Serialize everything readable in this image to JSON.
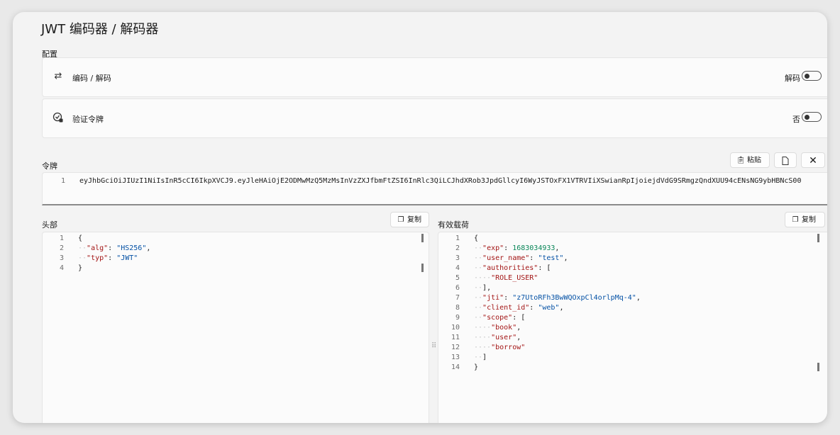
{
  "app": {
    "title": "JWT 编码器 / 解码器"
  },
  "config": {
    "section_label": "配置",
    "encode_decode": {
      "icon": "arrows-swap-icon",
      "label": "编码 / 解码",
      "state": "解码",
      "toggle_on": false
    },
    "verify_token": {
      "icon": "check-badge-icon",
      "label": "验证令牌",
      "state": "否",
      "toggle_on": false
    }
  },
  "token": {
    "section_label": "令牌",
    "paste_label": "粘贴",
    "line_number": "1",
    "value": "eyJhbGciOiJIUzI1NiIsInR5cCI6IkpXVCJ9.eyJleHAiOjE2ODMwMzQ5MzMsInVzZXJfbmFtZSI6InRlc3QiLCJhdXRob3JpdGllcyI6WyJSTOxFX1VTRVIiXSwianRpIjoiejdVdG9SRmgzQndXUU94cENsNG9ybHBNcS00"
  },
  "header": {
    "section_label": "头部",
    "copy_label": "复制",
    "lines": [
      {
        "n": "1",
        "indent": 0,
        "parts": [
          [
            "p",
            "{"
          ]
        ]
      },
      {
        "n": "2",
        "indent": 1,
        "parts": [
          [
            "k",
            "\"alg\""
          ],
          [
            "p",
            ": "
          ],
          [
            "s",
            "\"HS256\""
          ],
          [
            "p",
            ","
          ]
        ]
      },
      {
        "n": "3",
        "indent": 1,
        "parts": [
          [
            "k",
            "\"typ\""
          ],
          [
            "p",
            ": "
          ],
          [
            "s",
            "\"JWT\""
          ]
        ]
      },
      {
        "n": "4",
        "indent": 0,
        "parts": [
          [
            "p",
            "}"
          ]
        ]
      }
    ]
  },
  "payload": {
    "section_label": "有效载荷",
    "copy_label": "复制",
    "lines": [
      {
        "n": "1",
        "indent": 0,
        "parts": [
          [
            "p",
            "{"
          ]
        ]
      },
      {
        "n": "2",
        "indent": 1,
        "parts": [
          [
            "k",
            "\"exp\""
          ],
          [
            "p",
            ": "
          ],
          [
            "num",
            "1683034933"
          ],
          [
            "p",
            ","
          ]
        ]
      },
      {
        "n": "3",
        "indent": 1,
        "parts": [
          [
            "k",
            "\"user_name\""
          ],
          [
            "p",
            ": "
          ],
          [
            "s",
            "\"test\""
          ],
          [
            "p",
            ","
          ]
        ]
      },
      {
        "n": "4",
        "indent": 1,
        "parts": [
          [
            "k",
            "\"authorities\""
          ],
          [
            "p",
            ": ["
          ]
        ]
      },
      {
        "n": "5",
        "indent": 2,
        "parts": [
          [
            "k",
            "\"ROLE_USER\""
          ]
        ]
      },
      {
        "n": "6",
        "indent": 1,
        "parts": [
          [
            "p",
            "],"
          ]
        ]
      },
      {
        "n": "7",
        "indent": 1,
        "parts": [
          [
            "k",
            "\"jti\""
          ],
          [
            "p",
            ": "
          ],
          [
            "s",
            "\"z7UtoRFh3BwWQOxpCl4orlpMq-4\""
          ],
          [
            "p",
            ","
          ]
        ]
      },
      {
        "n": "8",
        "indent": 1,
        "parts": [
          [
            "k",
            "\"client_id\""
          ],
          [
            "p",
            ": "
          ],
          [
            "s",
            "\"web\""
          ],
          [
            "p",
            ","
          ]
        ]
      },
      {
        "n": "9",
        "indent": 1,
        "parts": [
          [
            "k",
            "\"scope\""
          ],
          [
            "p",
            ": ["
          ]
        ]
      },
      {
        "n": "10",
        "indent": 2,
        "parts": [
          [
            "k",
            "\"book\""
          ],
          [
            "p",
            ","
          ]
        ]
      },
      {
        "n": "11",
        "indent": 2,
        "parts": [
          [
            "k",
            "\"user\""
          ],
          [
            "p",
            ","
          ]
        ]
      },
      {
        "n": "12",
        "indent": 2,
        "parts": [
          [
            "k",
            "\"borrow\""
          ]
        ]
      },
      {
        "n": "13",
        "indent": 1,
        "parts": [
          [
            "p",
            "]"
          ]
        ]
      },
      {
        "n": "14",
        "indent": 0,
        "parts": [
          [
            "p",
            "}"
          ]
        ]
      }
    ]
  }
}
